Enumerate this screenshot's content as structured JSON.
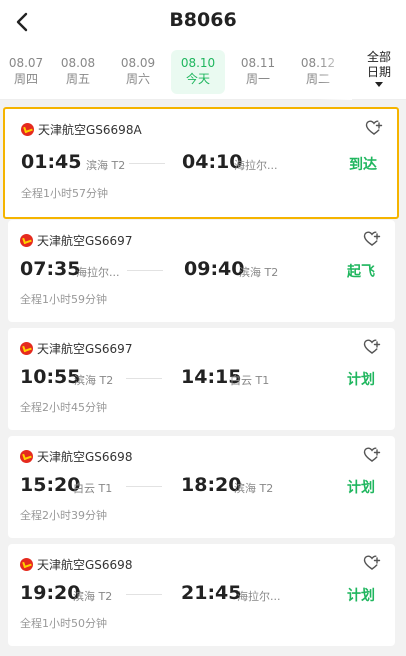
{
  "header": {
    "title": "B8066"
  },
  "dates": [
    {
      "date": "08.07",
      "weekday": "周四"
    },
    {
      "date": "08.08",
      "weekday": "周五"
    },
    {
      "date": "08.09",
      "weekday": "周六"
    },
    {
      "date": "08.10",
      "weekday": "今天"
    },
    {
      "date": "08.11",
      "weekday": "周一"
    },
    {
      "date": "08.12",
      "weekday": "周二"
    }
  ],
  "all_dates": {
    "line1": "全部",
    "line2": "日期"
  },
  "colors": {
    "accent": "#1fb65e",
    "highlight_border": "#f5b400",
    "airline_logo": "#e52a1e"
  },
  "flights": [
    {
      "airline": "天津航空GS6698A",
      "dep_time": "01:45",
      "dep_airport": "滨海 T2",
      "arr_time": "04:10",
      "arr_airport": "海拉尔...",
      "status": "到达",
      "duration": "全程1小时57分钟"
    },
    {
      "airline": "天津航空GS6697",
      "dep_time": "07:35",
      "dep_airport": "海拉尔...",
      "arr_time": "09:40",
      "arr_airport": "滨海 T2",
      "status": "起飞",
      "duration": "全程1小时59分钟"
    },
    {
      "airline": "天津航空GS6697",
      "dep_time": "10:55",
      "dep_airport": "滨海 T2",
      "arr_time": "14:15",
      "arr_airport": "白云 T1",
      "status": "计划",
      "duration": "全程2小时45分钟"
    },
    {
      "airline": "天津航空GS6698",
      "dep_time": "15:20",
      "dep_airport": "白云 T1",
      "arr_time": "18:20",
      "arr_airport": "滨海 T2",
      "status": "计划",
      "duration": "全程2小时39分钟"
    },
    {
      "airline": "天津航空GS6698",
      "dep_time": "19:20",
      "dep_airport": "滨海 T2",
      "arr_time": "21:45",
      "arr_airport": "海拉尔...",
      "status": "计划",
      "duration": "全程1小时50分钟"
    }
  ]
}
